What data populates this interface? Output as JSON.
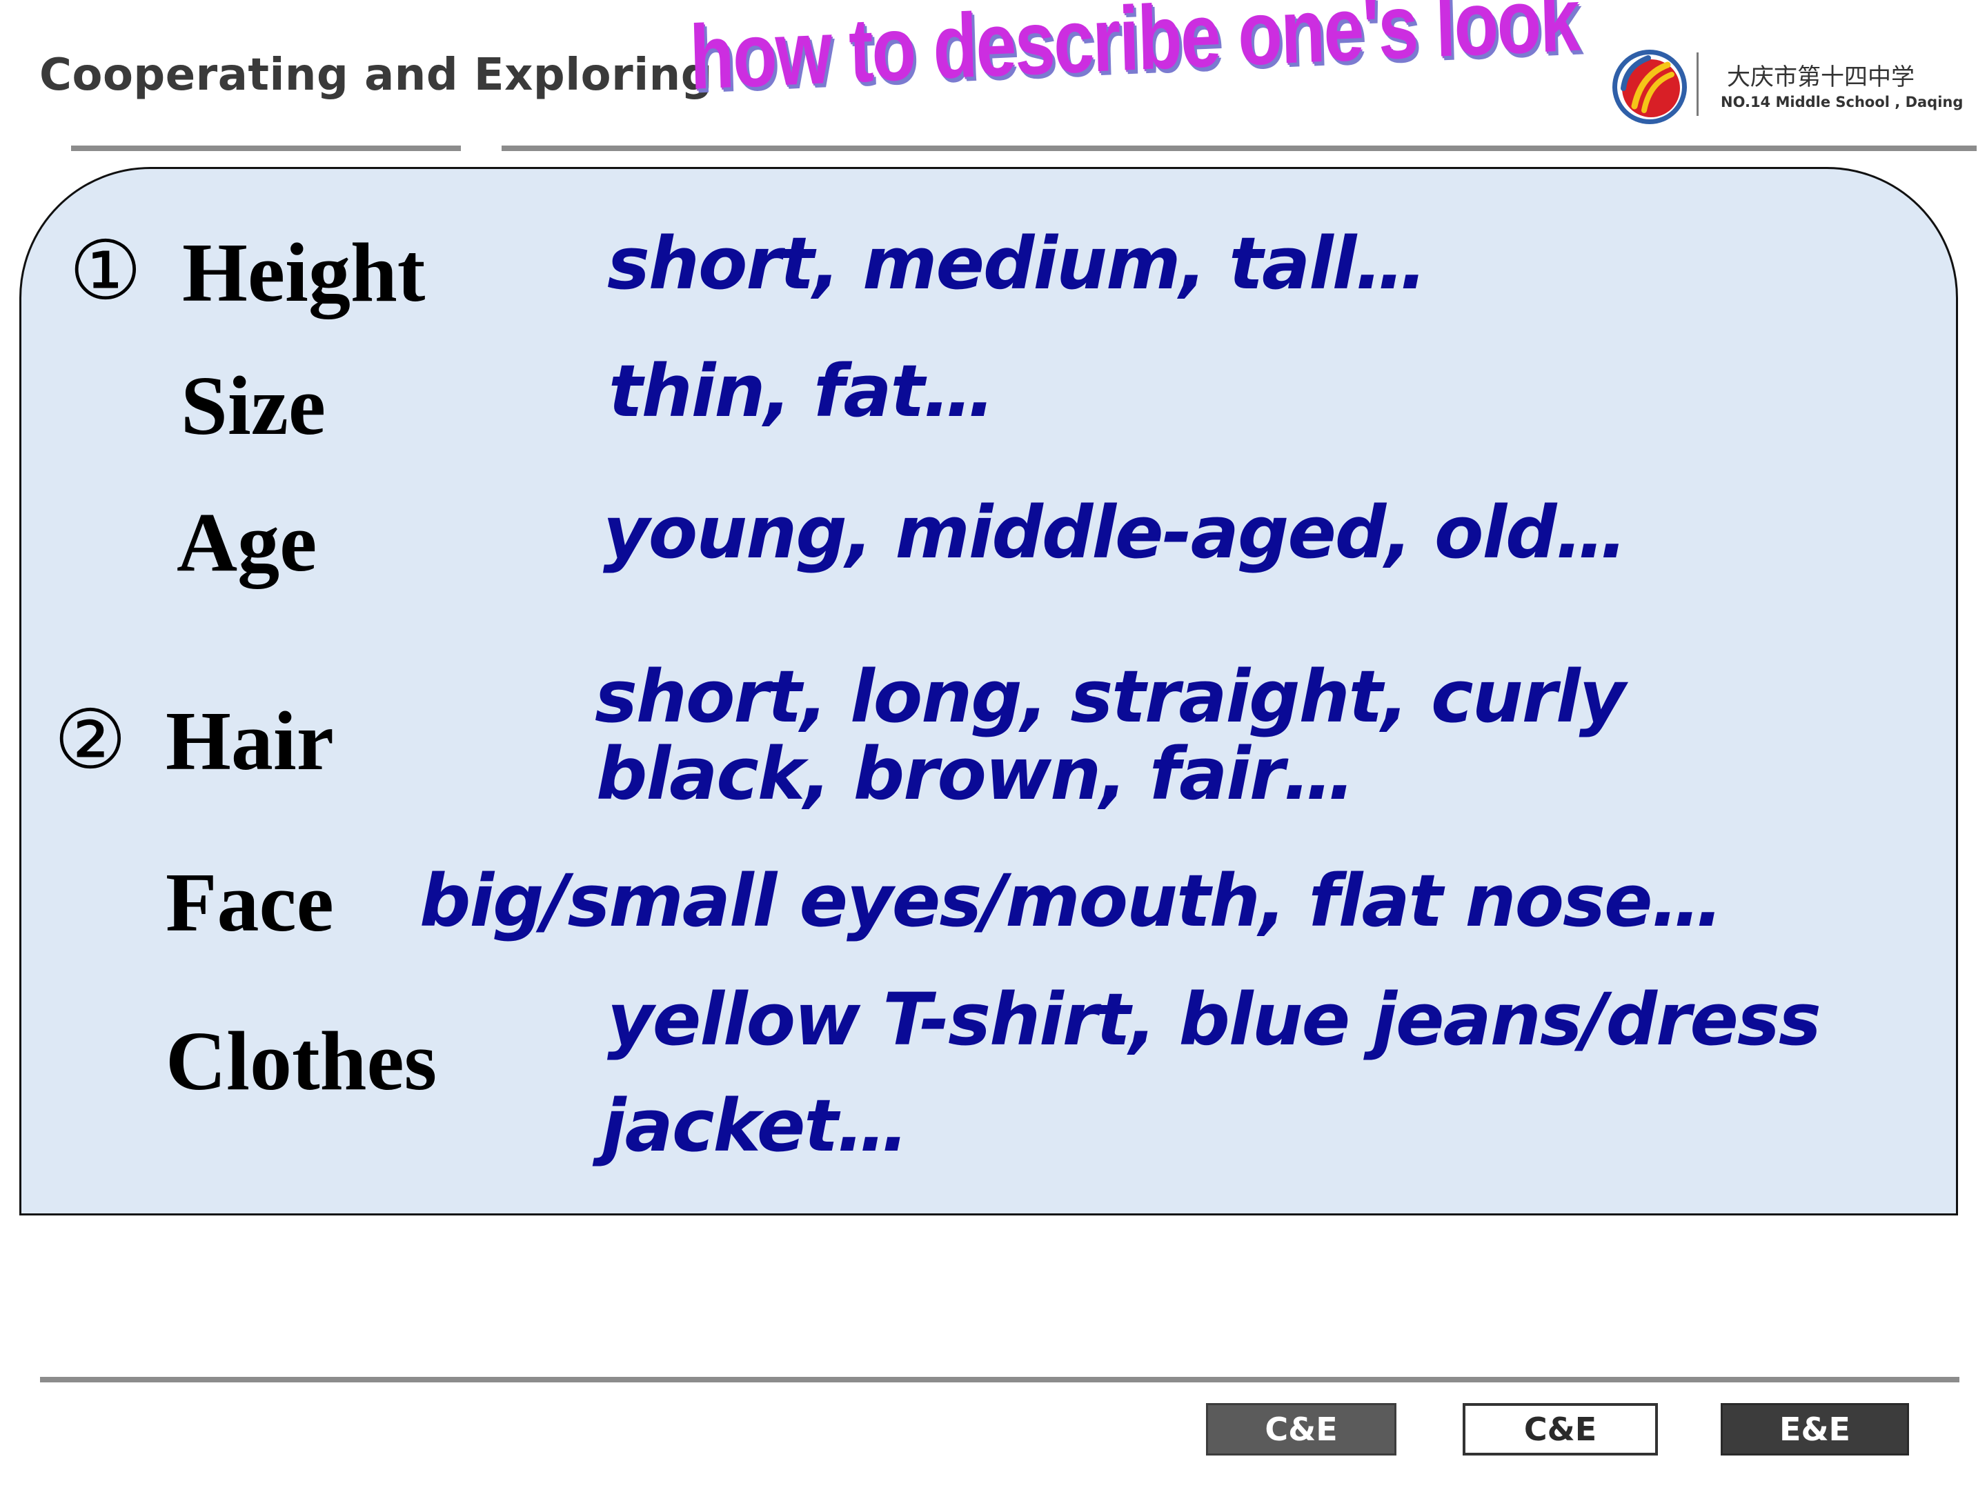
{
  "header": {
    "section_title": "Cooperating and Exploring",
    "wordart_title": "how to describe one's look",
    "school_name_cn": "大庆市第十四中学",
    "school_name_en": "NO.14 Middle School , Daqing",
    "logo_icon": "school-logo-icon"
  },
  "main": {
    "groups": [
      {
        "marker": "①",
        "items": [
          {
            "label": "Height",
            "values": [
              "short,  medium,  tall…"
            ]
          },
          {
            "label": "Size",
            "values": [
              "thin, fat…"
            ]
          },
          {
            "label": "Age",
            "values": [
              "young, middle-aged, old…"
            ]
          }
        ]
      },
      {
        "marker": "②",
        "items": [
          {
            "label": "Hair",
            "values": [
              "short,  long,  straight, curly",
              "black,  brown,  fair…"
            ]
          },
          {
            "label": "Face",
            "values": [
              "big/small eyes/mouth,  flat nose…"
            ]
          },
          {
            "label": "Clothes",
            "values": [
              "yellow T-shirt,  blue jeans/dress",
              "jacket…"
            ]
          }
        ]
      }
    ]
  },
  "footer": {
    "nav_buttons": [
      {
        "label": "C&E"
      },
      {
        "label": "C&E"
      },
      {
        "label": "E&E"
      }
    ]
  },
  "colors": {
    "panel_background": "#dde8f5",
    "value_text": "#0a0a96",
    "wordart_fill": "#cc2ee0",
    "wordart_shadow": "#7b7bd0",
    "logo_red": "#d81f26",
    "logo_yellow": "#f5c518",
    "logo_blue": "#2f5fa8"
  }
}
